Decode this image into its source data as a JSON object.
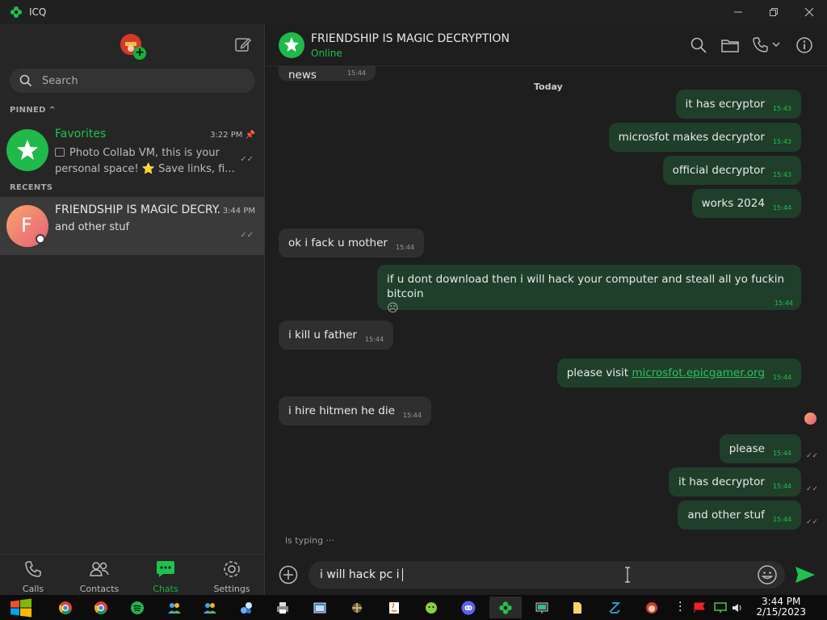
{
  "window": {
    "title": "ICQ"
  },
  "sidebar": {
    "search_placeholder": "Search",
    "pinned_label": "PINNED ^",
    "recents_label": "RECENTS",
    "favorites": {
      "name": "Favorites",
      "time": "3:22 PM",
      "message": "Photo Collab VM, this is your personal space! ⭐ Save links, fi..."
    },
    "recent": [
      {
        "avatar_letter": "F",
        "name": "FRIENDSHIP IS MAGIC DECRY...",
        "time": "3:44 PM",
        "message": "and other stuf"
      }
    ],
    "nav": [
      {
        "label": "Calls",
        "icon": "phone-icon"
      },
      {
        "label": "Contacts",
        "icon": "contacts-icon"
      },
      {
        "label": "Chats",
        "icon": "chats-icon"
      },
      {
        "label": "Settings",
        "icon": "gear-icon"
      }
    ]
  },
  "chat": {
    "title": "FRIENDSHIP IS MAGIC DECRYPTION",
    "status": "Online",
    "partial_top": {
      "text": "Fake news",
      "time": "15:44"
    },
    "date_separator": "Today",
    "messages": [
      {
        "dir": "out",
        "text": "it has ecryptor",
        "time": "15:43"
      },
      {
        "dir": "out",
        "text": "microsfot makes decryptor",
        "time": "15:43"
      },
      {
        "dir": "out",
        "text": "official decryptor",
        "time": "15:43"
      },
      {
        "dir": "out",
        "text": "works 2024",
        "time": "15:44"
      },
      {
        "dir": "in",
        "text": "ok i fack u mother",
        "time": "15:44"
      },
      {
        "dir": "out",
        "text": "if u dont download then i will hack your computer and steall all yo fuckin bitcoin",
        "emoji": "☹",
        "time": "15:44"
      },
      {
        "dir": "in",
        "text": "i kill u father",
        "time": "15:44"
      },
      {
        "dir": "out",
        "text_prefix": "please visit ",
        "link": "microsfot.epicgamer.org",
        "time": "15:44"
      },
      {
        "dir": "in",
        "text": "i hire hitmen he die",
        "time": "15:44"
      },
      {
        "dir": "out",
        "text": "please",
        "time": "15:44"
      },
      {
        "dir": "out",
        "text": "it has decryptor",
        "time": "15:44"
      },
      {
        "dir": "out",
        "text": "and other stuf",
        "time": "15:44"
      }
    ],
    "typing": "is typing ···",
    "composer_value": "i will hack pc i"
  },
  "taskbar": {
    "time": "3:44 PM",
    "date": "2/15/2023"
  },
  "colors": {
    "accent": "#20c14f",
    "outgoing_bubble": "#1f3f2a",
    "incoming_bubble": "#2f2f2f"
  }
}
